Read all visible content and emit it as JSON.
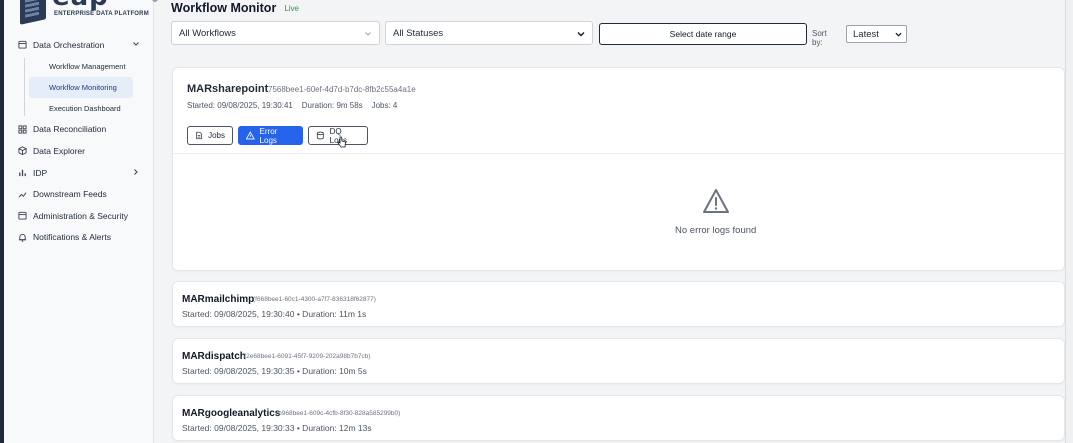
{
  "brand": {
    "logo_word": "eap",
    "tagline": "ENTERPRISE DATA PLATFORM"
  },
  "sidebar": {
    "items": [
      {
        "label": "Data Orchestration",
        "icon": "calendar-icon",
        "expanded": true,
        "children": [
          {
            "label": "Workflow Management"
          },
          {
            "label": "Workflow Monitoring",
            "active": true
          },
          {
            "label": "Execution Dashboard"
          }
        ]
      },
      {
        "label": "Data Reconciliation",
        "icon": "grid-icon"
      },
      {
        "label": "Data Explorer",
        "icon": "cube-icon"
      },
      {
        "label": "IDP",
        "icon": "chart-icon"
      },
      {
        "label": "Downstream Feeds",
        "icon": "trend-icon"
      },
      {
        "label": "Administration & Security",
        "icon": "calendar-icon"
      },
      {
        "label": "Notifications & Alerts",
        "icon": "bell-icon"
      }
    ]
  },
  "header": {
    "title": "Workflow Monitor",
    "status": "Live"
  },
  "filters": {
    "workflow_select": "All Workflows",
    "status_select": "All Statuses",
    "date_range_button": "Select date range",
    "sort_label": "Sort by:",
    "sort_value": "Latest"
  },
  "expanded_workflow": {
    "name": "MARsharepoint",
    "id": "7568bee1-60ef-4d7d-b7dc-8fb2c55a4a1e",
    "started": "Started: 09/08/2025, 19:30:41",
    "duration": "Duration: 9m 58s",
    "jobs": "Jobs: 4",
    "tabs": [
      {
        "label": "Jobs",
        "icon": "document-icon"
      },
      {
        "label": "Error Logs",
        "icon": "warning-icon",
        "active": true
      },
      {
        "label": "DQ Logs",
        "icon": "database-icon"
      }
    ],
    "empty_message": "No error logs found"
  },
  "workflows": [
    {
      "name": "MARmailchimp",
      "id": "(f668bee1-60c1-4300-a7f7-836318f62877)",
      "meta": "Started: 09/08/2025, 19:30:40 • Duration: 11m 1s"
    },
    {
      "name": "MARdispatch",
      "id": "(2e68bee1-6091-45f7-9209-202a98b7b7cb)",
      "meta": "Started: 09/08/2025, 19:30:35 • Duration: 10m 5s"
    },
    {
      "name": "MARgoogleanalytics",
      "id": "(b968bee1-609c-4cfb-8f30-828a585299b0)",
      "meta": "Started: 09/08/2025, 19:30:33 • Duration: 12m 13s"
    }
  ],
  "colors": {
    "accent": "#2563eb",
    "live": "#16a34a",
    "active_nav_bg": "#e5edf8"
  }
}
